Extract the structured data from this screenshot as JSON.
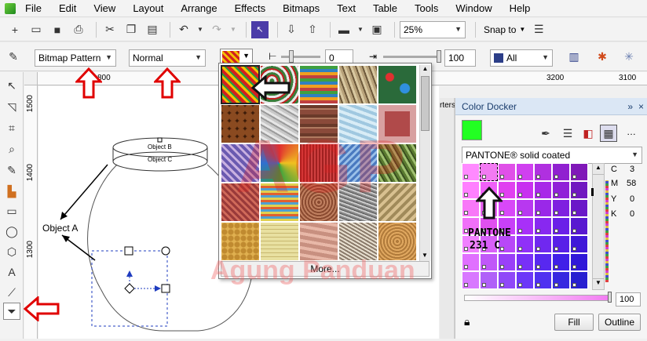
{
  "menu": [
    "File",
    "Edit",
    "View",
    "Layout",
    "Arrange",
    "Effects",
    "Bitmaps",
    "Text",
    "Table",
    "Tools",
    "Window",
    "Help"
  ],
  "toolbar1": {
    "zoom_value": "25%",
    "snap_label": "Snap to"
  },
  "propbar": {
    "fill_type": "Bitmap Pattern",
    "merge_mode": "Normal",
    "transparency_start": "0",
    "transparency_end": "100",
    "target": "All"
  },
  "rulers": {
    "top_left": "800",
    "top_right1": "3200",
    "top_right2": "3100",
    "left": [
      "1500",
      "1400",
      "1300"
    ]
  },
  "popup": {
    "more_label": "More..."
  },
  "canvas": {
    "object_a": "Object A",
    "object_b": "Object B",
    "object_c": "Object C"
  },
  "docker": {
    "title": "Color Docker",
    "side_tab": "rters",
    "palette": "PANTONE® solid coated",
    "swatch_name_1": "PANTONE",
    "swatch_name_2": "231 C",
    "c_label": "C",
    "c_value": "3",
    "m_label": "M",
    "m_value": "58",
    "y_label": "Y",
    "y_value": "0",
    "k_label": "K",
    "k_value": "0",
    "tint_value": "100",
    "fill_button": "Fill",
    "outline_button": "Outline",
    "current_color": "#22ff22"
  },
  "watermark": {
    "logo": "AGP",
    "name": "Agung Panduan"
  }
}
